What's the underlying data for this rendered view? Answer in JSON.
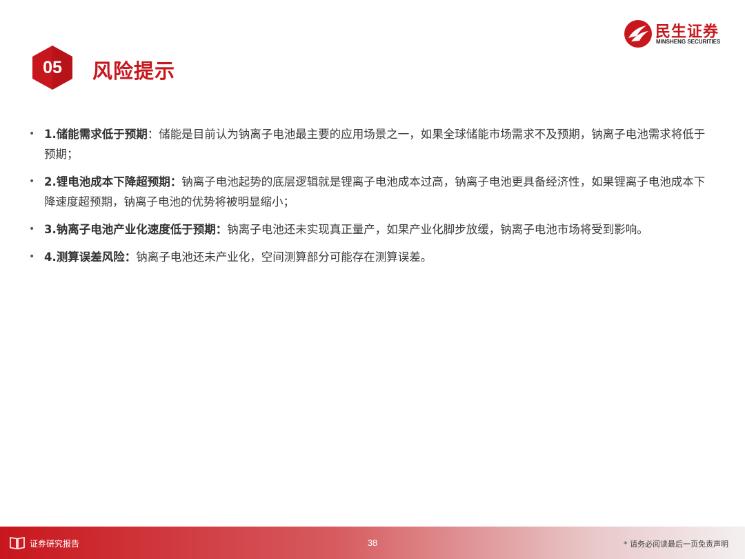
{
  "header": {
    "section_number": "05",
    "section_title": "风险提示"
  },
  "logo": {
    "cn": "民生证券",
    "en": "MINSHENG SECURITIES",
    "brand_color": "#c8161d"
  },
  "bullets": [
    {
      "head": "1.储能需求低于预期",
      "sep": "：",
      "body": "储能是目前认为钠离子电池最主要的应用场景之一，如果全球储能市场需求不及预期，钠离子电池需求将低于预期；"
    },
    {
      "head": "2.锂电池成本下降超预期：",
      "sep": "",
      "body": "钠离子电池起势的底层逻辑就是锂离子电池成本过高，钠离子电池更具备经济性，如果锂离子电池成本下降速度超预期，钠离子电池的优势将被明显缩小；"
    },
    {
      "head": "3.钠离子电池产业化速度低于预期：",
      "sep": "",
      "body": "钠离子电池还未实现真正量产，如果产业化脚步放缓，钠离子电池市场将受到影响。"
    },
    {
      "head": "4.测算误差风险：",
      "sep": "",
      "body": "钠离子电池还未产业化，空间测算部分可能存在测算误差。"
    }
  ],
  "footer": {
    "label": "证券研究报告",
    "page": "38",
    "note": "* 请务必阅读最后一页免责声明",
    "book_icon": "book-icon"
  }
}
